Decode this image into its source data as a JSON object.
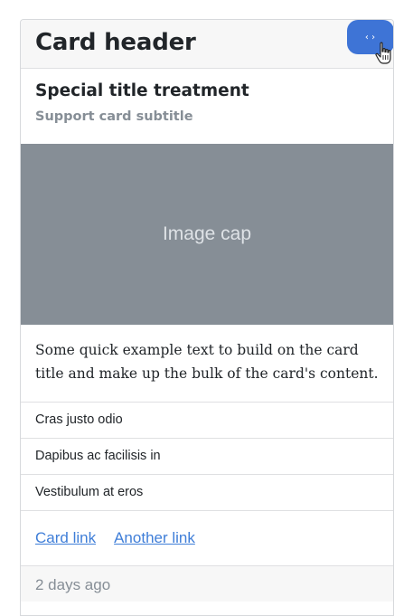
{
  "header": {
    "title": "Card header",
    "code_toggle_label": "‹›"
  },
  "body": {
    "title": "Special title treatment",
    "subtitle": "Support card subtitle",
    "image_cap_text": "Image cap",
    "text": "Some quick example text to build on the card title and make up the bulk of the card's content."
  },
  "list": {
    "items": [
      {
        "label": "Cras justo odio"
      },
      {
        "label": "Dapibus ac facilisis in"
      },
      {
        "label": "Vestibulum at eros"
      }
    ]
  },
  "links": {
    "first": "Card link",
    "second": "Another link"
  },
  "footer": {
    "text": "2 days ago"
  },
  "colors": {
    "accent": "#3e74d6",
    "link": "#3f7ed8",
    "muted": "#868e96",
    "image_bg": "#868e96"
  },
  "icons": {
    "code_toggle": "code-icon",
    "cursor": "hand-pointer-icon"
  }
}
